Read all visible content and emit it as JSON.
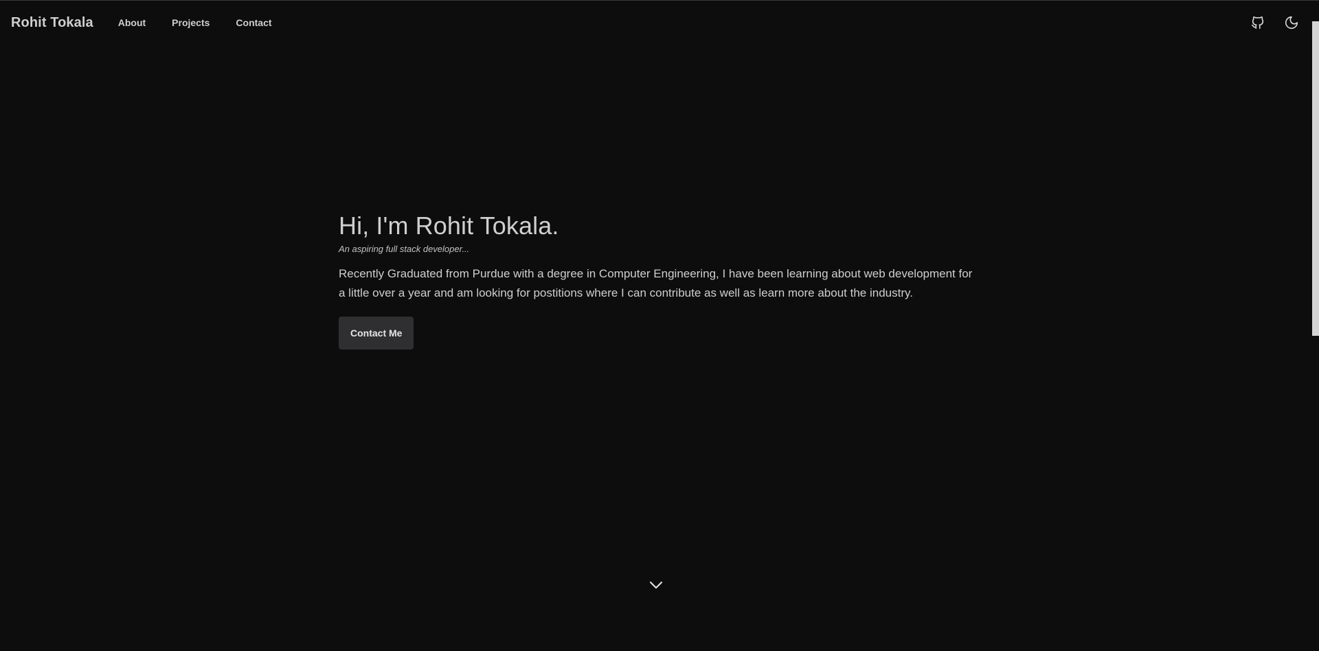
{
  "navbar": {
    "brand": "Rohit Tokala",
    "links": [
      {
        "label": "About"
      },
      {
        "label": "Projects"
      },
      {
        "label": "Contact"
      }
    ],
    "icons": [
      "github-icon",
      "moon-icon"
    ]
  },
  "hero": {
    "title": "Hi, I'm Rohit Tokala.",
    "subtitle": "An aspiring full stack developer...",
    "body": "Recently Graduated from Purdue with a degree in Computer Engineering, I have been learning about web development for a little over a year and am looking for postitions where I can contribute as well as learn more about the industry.",
    "cta_label": "Contact Me"
  },
  "scroll": {
    "icon": "chevron-down-icon"
  },
  "colors": {
    "background": "#0d0d0d",
    "text": "#cfcfcf",
    "button": "#2f2f31",
    "scrollbar_thumb": "#d4d4d4"
  }
}
